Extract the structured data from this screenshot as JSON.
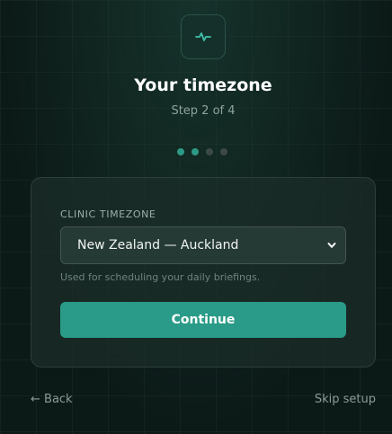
{
  "header": {
    "title": "Your timezone",
    "step_text": "Step 2 of 4",
    "icon": "pulse-icon"
  },
  "progress": {
    "current_step": 2,
    "total_steps": 4,
    "active_color": "#2d9a86"
  },
  "form": {
    "field_label": "CLINIC TIMEZONE",
    "selected_value": "New Zealand — Auckland",
    "help_text": "Used for scheduling your daily briefings.",
    "continue_label": "Continue"
  },
  "footer": {
    "back_label": "← Back",
    "skip_label": "Skip setup"
  },
  "colors": {
    "accent": "#2a9b88",
    "background": "#0c1a17"
  }
}
